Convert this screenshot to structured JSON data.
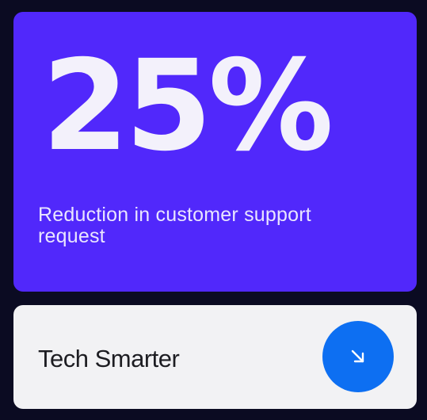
{
  "stat": {
    "value": "25%",
    "caption": "Reduction in customer support request"
  },
  "link": {
    "label": "Tech Smarter",
    "action_icon": "arrow-down-right-icon"
  },
  "colors": {
    "background": "#0b0b22",
    "stat_card": "#5128fb",
    "link_card": "#f2f2f4",
    "accent": "#0d6ff2",
    "text_light": "#f3f1fb",
    "text_dark": "#1d1d22"
  }
}
